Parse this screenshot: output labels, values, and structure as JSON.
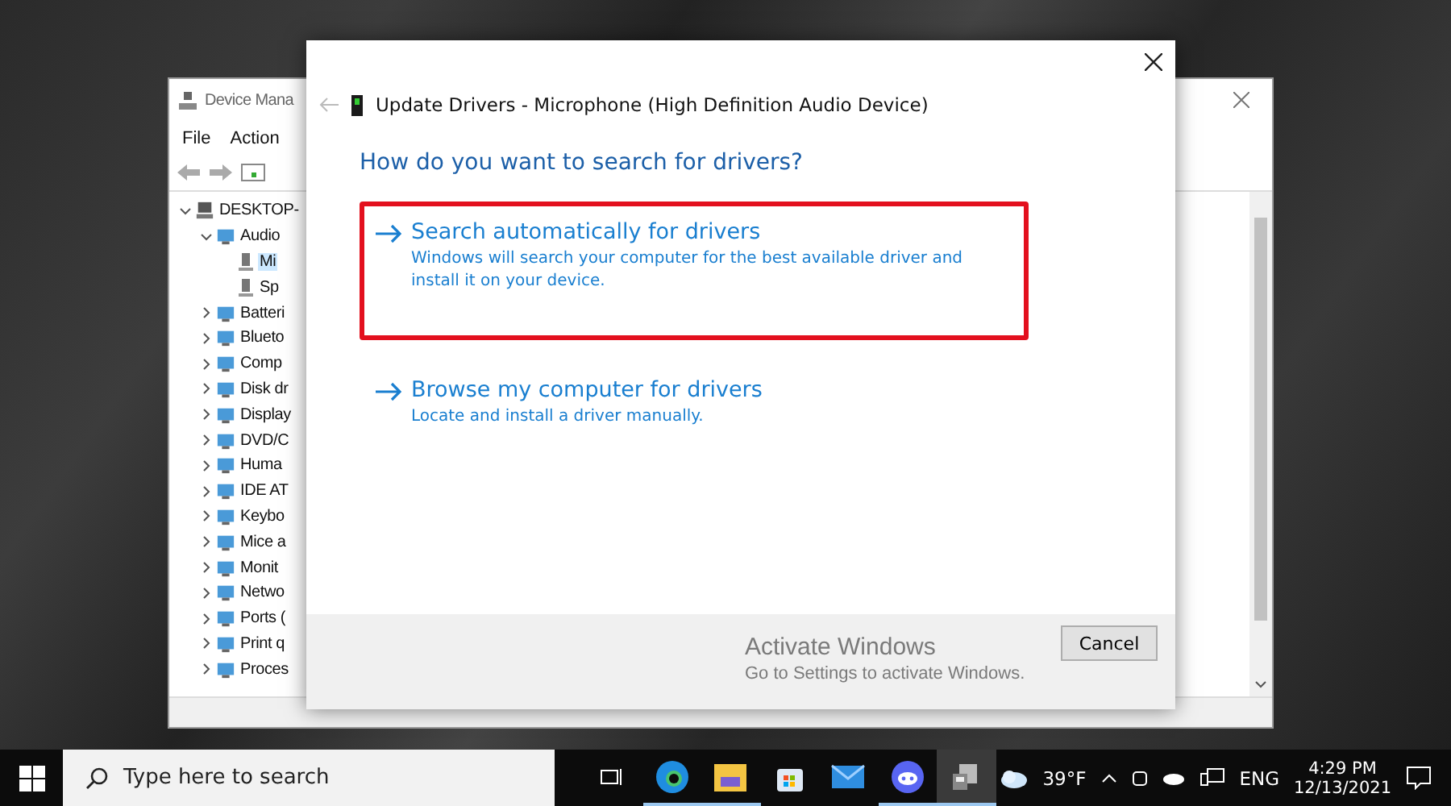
{
  "device_manager": {
    "title": "Device Mana",
    "menu": [
      "File",
      "Action"
    ],
    "tree": [
      {
        "label": "DESKTOP-",
        "kind": "computer",
        "expanded": true,
        "selected": false,
        "children": [
          {
            "label": "Audio",
            "kind": "category",
            "expanded": true,
            "selected": false,
            "children": [
              {
                "label": "Mi",
                "kind": "device",
                "selected": true
              },
              {
                "label": "Sp",
                "kind": "device",
                "selected": false
              }
            ]
          },
          {
            "label": "Batteri",
            "kind": "category",
            "expanded": false,
            "selected": false
          },
          {
            "label": "Blueto",
            "kind": "category",
            "expanded": false,
            "selected": false
          },
          {
            "label": "Comp",
            "kind": "category",
            "expanded": false,
            "selected": false
          },
          {
            "label": "Disk dr",
            "kind": "category",
            "expanded": false,
            "selected": false
          },
          {
            "label": "Display",
            "kind": "category",
            "expanded": false,
            "selected": false
          },
          {
            "label": "DVD/C",
            "kind": "category",
            "expanded": false,
            "selected": false
          },
          {
            "label": "Huma",
            "kind": "category",
            "expanded": false,
            "selected": false
          },
          {
            "label": "IDE AT",
            "kind": "category",
            "expanded": false,
            "selected": false
          },
          {
            "label": "Keybo",
            "kind": "category",
            "expanded": false,
            "selected": false
          },
          {
            "label": "Mice a",
            "kind": "category",
            "expanded": false,
            "selected": false
          },
          {
            "label": "Monit",
            "kind": "category",
            "expanded": false,
            "selected": false
          },
          {
            "label": "Netwo",
            "kind": "category",
            "expanded": false,
            "selected": false
          },
          {
            "label": "Ports (",
            "kind": "category",
            "expanded": false,
            "selected": false
          },
          {
            "label": "Print q",
            "kind": "category",
            "expanded": false,
            "selected": false
          },
          {
            "label": "Proces",
            "kind": "category",
            "expanded": false,
            "selected": false
          }
        ]
      }
    ]
  },
  "dialog": {
    "title": "Update Drivers - Microphone (High Definition Audio Device)",
    "heading": "How do you want to search for drivers?",
    "options": [
      {
        "title": "Search automatically for drivers",
        "description": "Windows will search your computer for the best available driver and install it on your device.",
        "highlighted": true
      },
      {
        "title": "Browse my computer for drivers",
        "description": "Locate and install a driver manually.",
        "highlighted": false
      }
    ],
    "cancel": "Cancel"
  },
  "watermark": {
    "title": "Activate Windows",
    "subtitle": "Go to Settings to activate Windows."
  },
  "taskbar": {
    "search": {
      "placeholder": "Type here to search"
    },
    "apps": [
      {
        "kind": "task-view",
        "running": false,
        "active": false
      },
      {
        "kind": "edge",
        "running": true,
        "active": false
      },
      {
        "kind": "explorer",
        "running": true,
        "active": false
      },
      {
        "kind": "store",
        "running": false,
        "active": false
      },
      {
        "kind": "mail",
        "running": false,
        "active": false
      },
      {
        "kind": "discord",
        "running": true,
        "active": false
      },
      {
        "kind": "device-manager",
        "running": true,
        "active": true
      }
    ],
    "weather": "39°F",
    "language": "ENG",
    "time": "4:29 PM",
    "date": "12/13/2021"
  }
}
